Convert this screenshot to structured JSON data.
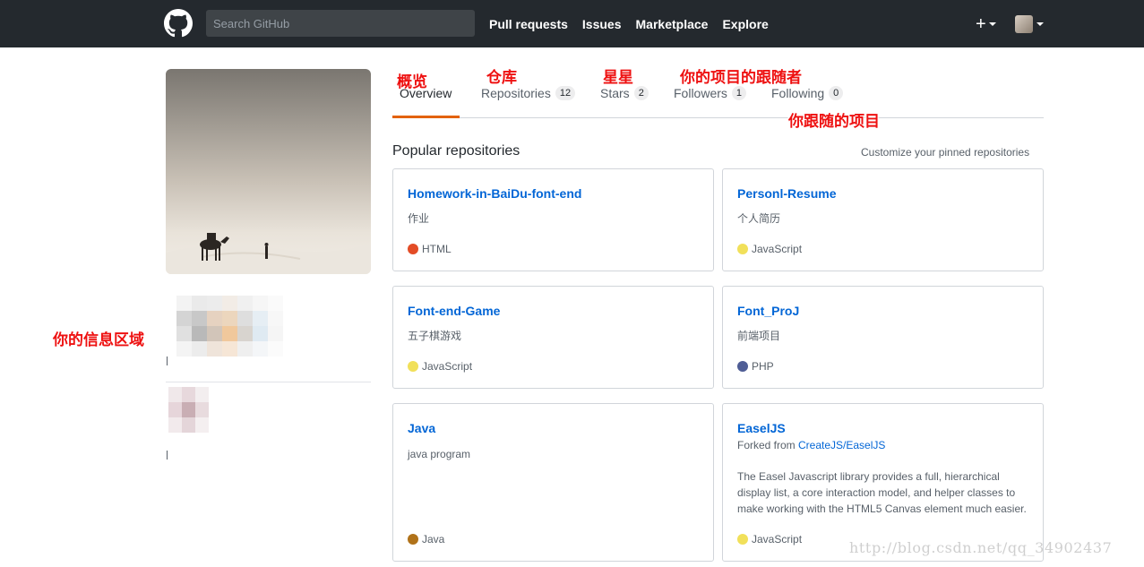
{
  "header": {
    "search_placeholder": "Search GitHub",
    "nav": [
      "Pull requests",
      "Issues",
      "Marketplace",
      "Explore"
    ],
    "plus_label": "+"
  },
  "tabs": [
    {
      "label": "Overview",
      "count": null,
      "selected": true
    },
    {
      "label": "Repositories",
      "count": "12"
    },
    {
      "label": "Stars",
      "count": "2"
    },
    {
      "label": "Followers",
      "count": "1"
    },
    {
      "label": "Following",
      "count": "0"
    }
  ],
  "annotations": {
    "overview": "概览",
    "repositories": "仓库",
    "stars": "星星",
    "followers": "你的项目的跟随者",
    "following": "你跟随的项目",
    "info_area": "你的信息区域"
  },
  "popular": {
    "title": "Popular repositories",
    "customize": "Customize your pinned repositories",
    "repos": [
      {
        "name": "Homework-in-BaiDu-font-end",
        "desc": "作业",
        "lang": "HTML",
        "lang_color": "#e34c26"
      },
      {
        "name": "Personl-Resume",
        "desc": "个人简历",
        "lang": "JavaScript",
        "lang_color": "#f1e05a"
      },
      {
        "name": "Font-end-Game",
        "desc": "五子棋游戏",
        "lang": "JavaScript",
        "lang_color": "#f1e05a"
      },
      {
        "name": "Font_ProJ",
        "desc": "前端项目",
        "lang": "PHP",
        "lang_color": "#4f5d95"
      },
      {
        "name": "Java",
        "desc": "java program",
        "lang": "Java",
        "lang_color": "#b07219"
      },
      {
        "name": "EaselJS",
        "forked_prefix": "Forked from ",
        "forked_from": "CreateJS/EaselJS",
        "desc": "The Easel Javascript library provides a full, hierarchical display list, a core interaction model, and helper classes to make working with the HTML5 Canvas element much easier.",
        "lang": "JavaScript",
        "lang_color": "#f1e05a"
      }
    ]
  },
  "watermark": "http://blog.csdn.net/qq_34902437"
}
